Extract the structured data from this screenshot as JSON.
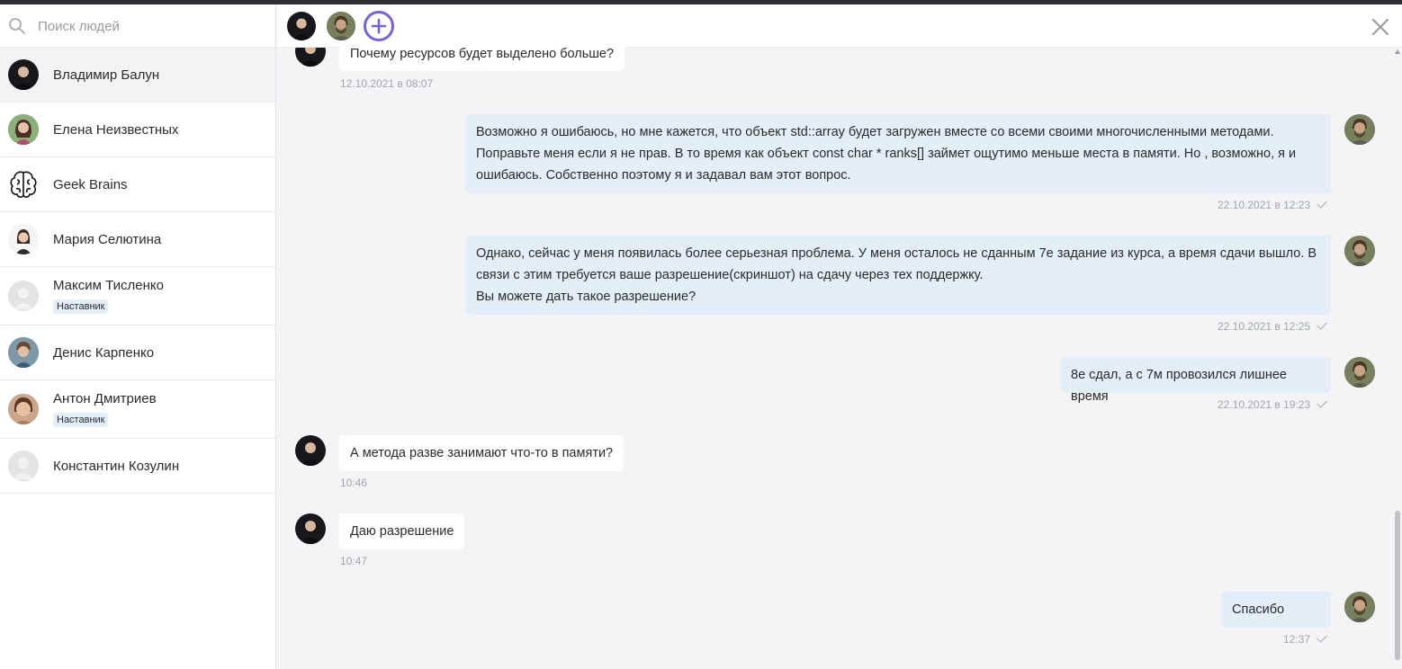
{
  "search": {
    "placeholder": "Поиск людей"
  },
  "contacts": [
    {
      "name": "Владимир Балун",
      "badge": ""
    },
    {
      "name": "Елена Неизвестных",
      "badge": ""
    },
    {
      "name": "Geek Brains",
      "badge": ""
    },
    {
      "name": "Мария Селютина",
      "badge": ""
    },
    {
      "name": "Максим Тисленко",
      "badge": "Наставник"
    },
    {
      "name": "Денис Карпенко",
      "badge": ""
    },
    {
      "name": "Антон Дмитриев",
      "badge": "Наставник"
    },
    {
      "name": "Константин Козулин",
      "badge": ""
    }
  ],
  "messages": [
    {
      "text": "Почему ресурсов будет выделено больше?",
      "time": "12.10.2021 в 08:07"
    },
    {
      "text": "Возможно я ошибаюсь, но мне кажется, что объект std::array будет загружен вместе со всеми своими многочисленными методами. Поправьте меня если я не прав. В то время как объект const char * ranks[] займет ощутимо меньше места в памяти. Но , возможно, я и ошибаюсь. Собственно поэтому я и задавал вам этот вопрос.",
      "time": "22.10.2021 в 12:23"
    },
    {
      "text_lines": [
        "Однако, сейчас у меня появилась более серьезная проблема. У меня осталось не сданным 7е задание из курса, а время сдачи вышло. В связи с этим требуется ваше разрешение(скриншот) на сдачу через тех поддержку.",
        "Вы можете дать такое разрешение?"
      ],
      "time": "22.10.2021 в 12:25"
    },
    {
      "text": "8е сдал, а с 7м провозился лишнее время",
      "time": "22.10.2021 в 19:23"
    },
    {
      "text": "А метода разве занимают что-то в памяти?",
      "time": "10:46"
    },
    {
      "text": "Даю разрешение",
      "time": "10:47"
    },
    {
      "text": "Спасибо",
      "time": "12:37"
    }
  ],
  "colors": {
    "accent": "#7b61d6",
    "outgoing_bubble": "#e3eef9",
    "incoming_bubble": "#ffffff",
    "badge_bg": "#e2effb"
  },
  "icons": {
    "search": "search-icon",
    "add": "plus-circle-icon",
    "close": "close-icon",
    "read": "check-icon"
  }
}
